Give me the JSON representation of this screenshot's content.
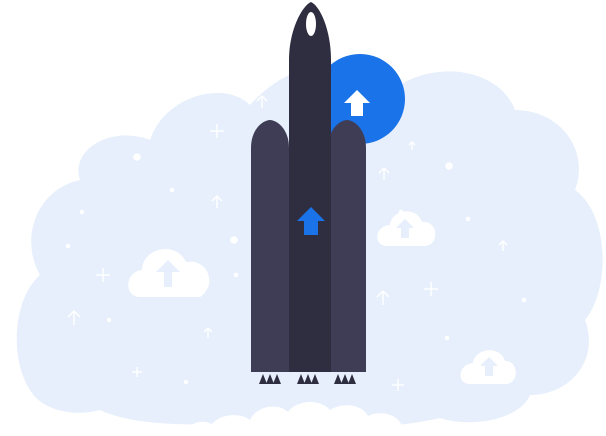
{
  "illustration": {
    "subject": "rocket-launch-upload",
    "colors": {
      "background": "#ffffff",
      "sky_cloud": "#e6effb",
      "cloud": "#ffffff",
      "rocket_body": "#2f2e41",
      "rocket_booster": "#3f3d56",
      "accent": "#1a73e8",
      "arrow": "#ffffff",
      "sparkle": "#ffffff"
    },
    "icons": [
      "rocket",
      "upload-arrow-icon",
      "cloud-upload-icon",
      "sparkle-arrow-icon",
      "plus-sparkle-icon"
    ]
  }
}
